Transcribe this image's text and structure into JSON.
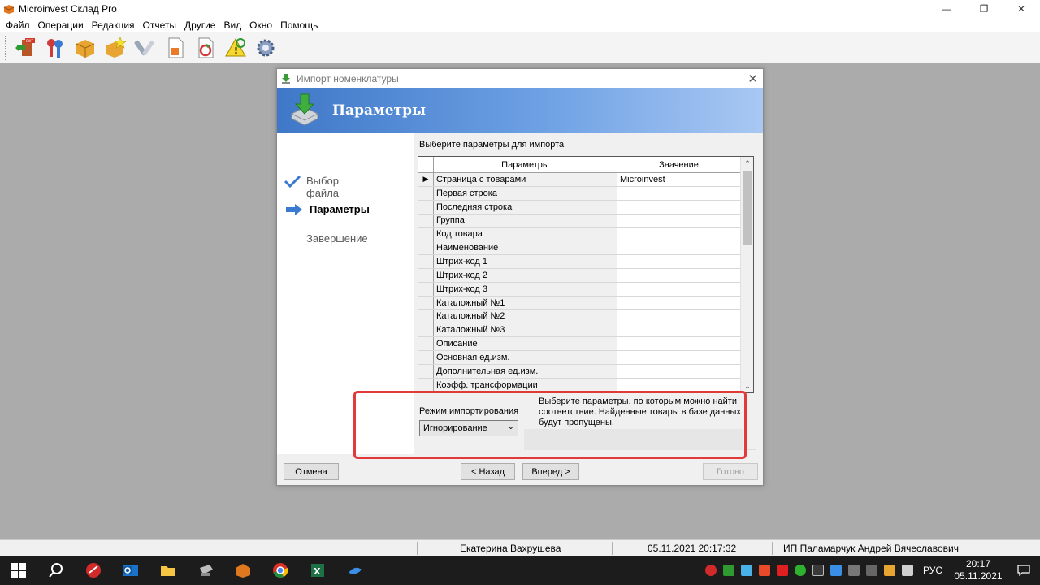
{
  "app": {
    "title": "Microinvest Склад Pro"
  },
  "window_controls": {
    "minimize": "—",
    "maximize": "❐",
    "close": "✕"
  },
  "menu": [
    "Файл",
    "Операции",
    "Редакция",
    "Отчеты",
    "Другие",
    "Вид",
    "Окно",
    "Помощь"
  ],
  "toolbar": {
    "buttons": [
      "exit-icon",
      "users-keys-icon",
      "package-icon",
      "new-package-icon",
      "tools-icon",
      "document-box-icon",
      "document-refresh-icon",
      "warning-refresh-icon",
      "gear-icon"
    ]
  },
  "dialog": {
    "title": "Импорт номенклатуры",
    "close": "✕",
    "header_title": "Параметры",
    "steps": [
      {
        "label": "Выбор файла",
        "state": "done"
      },
      {
        "label": "Параметры",
        "state": "active"
      },
      {
        "label": "Завершение",
        "state": "pending"
      }
    ],
    "caption": "Выберите параметры для импорта",
    "grid": {
      "columns": [
        "Параметры",
        "Значение"
      ],
      "rows": [
        {
          "param": "Страница с товарами",
          "value": "Microinvest",
          "current": true
        },
        {
          "param": "Первая строка",
          "value": ""
        },
        {
          "param": "Последняя строка",
          "value": ""
        },
        {
          "param": "Группа",
          "value": ""
        },
        {
          "param": "Код товара",
          "value": ""
        },
        {
          "param": "Наименование",
          "value": ""
        },
        {
          "param": "Штрих-код 1",
          "value": ""
        },
        {
          "param": "Штрих-код 2",
          "value": ""
        },
        {
          "param": "Штрих-код 3",
          "value": ""
        },
        {
          "param": "Каталожный №1",
          "value": ""
        },
        {
          "param": "Каталожный №2",
          "value": ""
        },
        {
          "param": "Каталожный №3",
          "value": ""
        },
        {
          "param": "Описание",
          "value": ""
        },
        {
          "param": "Основная ед.изм.",
          "value": ""
        },
        {
          "param": "Дополнительная ед.изм.",
          "value": ""
        },
        {
          "param": "Коэфф. трансформации",
          "value": ""
        }
      ],
      "current_marker": "▶"
    },
    "import_mode": {
      "label": "Режим импортирования",
      "selected": "Игнорирование",
      "chevron": "⌄"
    },
    "hint": "Выберите параметры, по которым можно найти соответствие. Найденные товары в базе данных будут пропущены.",
    "buttons": {
      "cancel": "Отмена",
      "back": "< Назад",
      "next": "Вперед >",
      "finish": "Готово"
    }
  },
  "statusbar": {
    "user": "Екатерина Вахрушева",
    "datetime": "05.11.2021 20:17:32",
    "company": "ИП Паламарчук Андрей Вячеславович"
  },
  "taskbar": {
    "apps": [
      "windows-start-icon",
      "search-icon",
      "microinvest-icon",
      "outlook-icon",
      "file-explorer-icon",
      "printer-app-icon",
      "warehouse-app-icon",
      "chrome-icon",
      "excel-icon",
      "edge-app-icon"
    ],
    "tray_icons": [
      "tray-app-red-icon",
      "tray-app-green-icon",
      "tray-vpn-icon",
      "tray-mail-icon",
      "tray-cdn-icon",
      "tray-app-icon",
      "tray-network-icon",
      "tray-app-blue-icon",
      "tray-keyboard-icon",
      "tray-lang-ru-icon",
      "tray-security-icon",
      "tray-volume-icon"
    ],
    "language": "РУС",
    "time": "20:17",
    "date": "05.11.2021"
  },
  "colors": {
    "header_gradient_start": "#3f78c8",
    "header_gradient_end": "#a9c8f2",
    "highlight_frame": "#e03a3a",
    "workspace": "#ababab",
    "taskbar": "#1c1c1c"
  }
}
